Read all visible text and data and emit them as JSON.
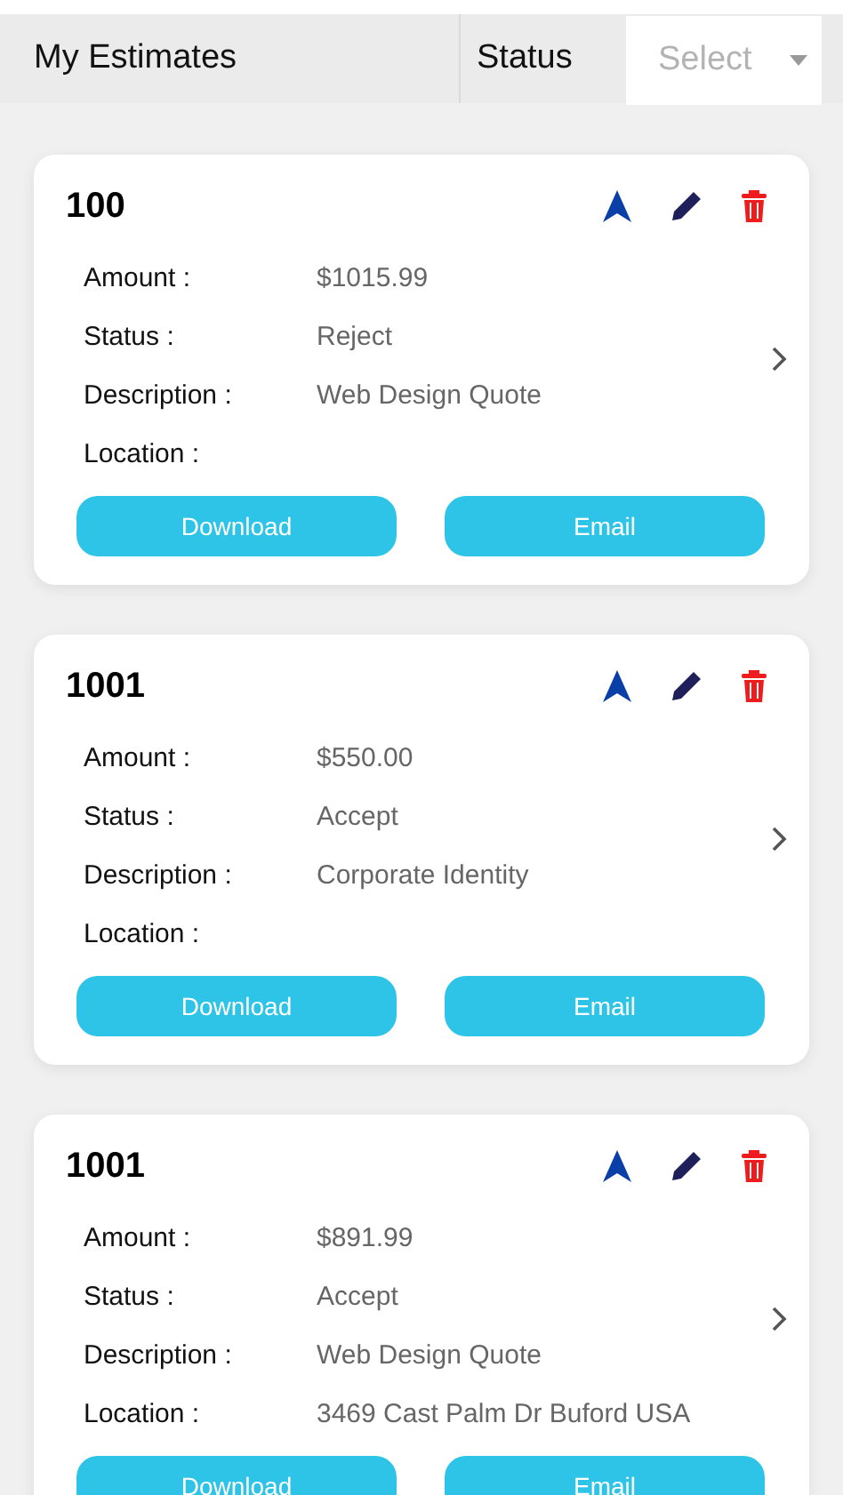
{
  "header": {
    "title": "My Estimates",
    "status_label": "Status",
    "select": {
      "placeholder": "Select"
    }
  },
  "estimates": [
    {
      "number": "100",
      "fields": [
        {
          "label": "Amount :",
          "value": "$1015.99"
        },
        {
          "label": "Status :",
          "value": "Reject"
        },
        {
          "label": "Description :",
          "value": "Web Design Quote"
        },
        {
          "label": "Location :"
        }
      ],
      "buttons": [
        "Download",
        "Email"
      ]
    },
    {
      "number": "1001",
      "fields": [
        {
          "label": "Amount :",
          "value": "$550.00"
        },
        {
          "label": "Status :",
          "value": "Accept"
        },
        {
          "label": "Description :",
          "value": "Corporate Identity"
        },
        {
          "label": "Location :"
        }
      ],
      "buttons": [
        "Download",
        "Email"
      ]
    },
    {
      "number": "1001",
      "fields": [
        {
          "label": "Amount :",
          "value": "$891.99"
        },
        {
          "label": "Status :",
          "value": "Accept"
        },
        {
          "label": "Description :",
          "value": "Web Design Quote"
        },
        {
          "label": "Location :",
          "value": "3469 Cast Palm Dr Buford USA"
        }
      ],
      "buttons": [
        "Download",
        "Email"
      ]
    }
  ]
}
